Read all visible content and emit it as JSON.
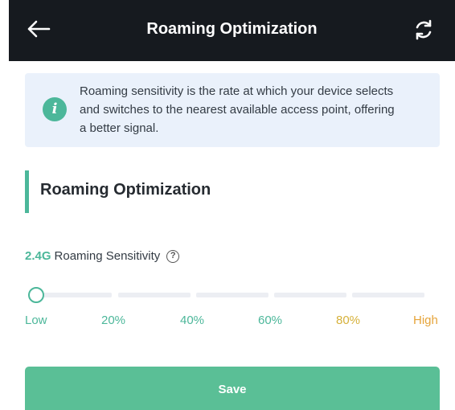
{
  "header": {
    "title": "Roaming Optimization",
    "back_icon": "arrow-left-icon",
    "refresh_icon": "refresh-icon"
  },
  "info": {
    "icon": "info-icon",
    "icon_glyph": "i",
    "text": "Roaming sensitivity is the rate at which your device selects and switches to the nearest available access point, offering a better signal."
  },
  "section": {
    "title": "Roaming Optimization"
  },
  "sensitivity": {
    "band": "2.4G",
    "label": "Roaming Sensitivity",
    "help_glyph": "?",
    "value": "Low",
    "ticks": [
      "Low",
      "20%",
      "40%",
      "60%",
      "80%",
      "High"
    ]
  },
  "actions": {
    "save_label": "Save"
  },
  "colors": {
    "accent": "#4cb79a",
    "header_bg": "#161a1f",
    "info_bg": "#eaf1fb",
    "save_bg": "#5abf96"
  }
}
